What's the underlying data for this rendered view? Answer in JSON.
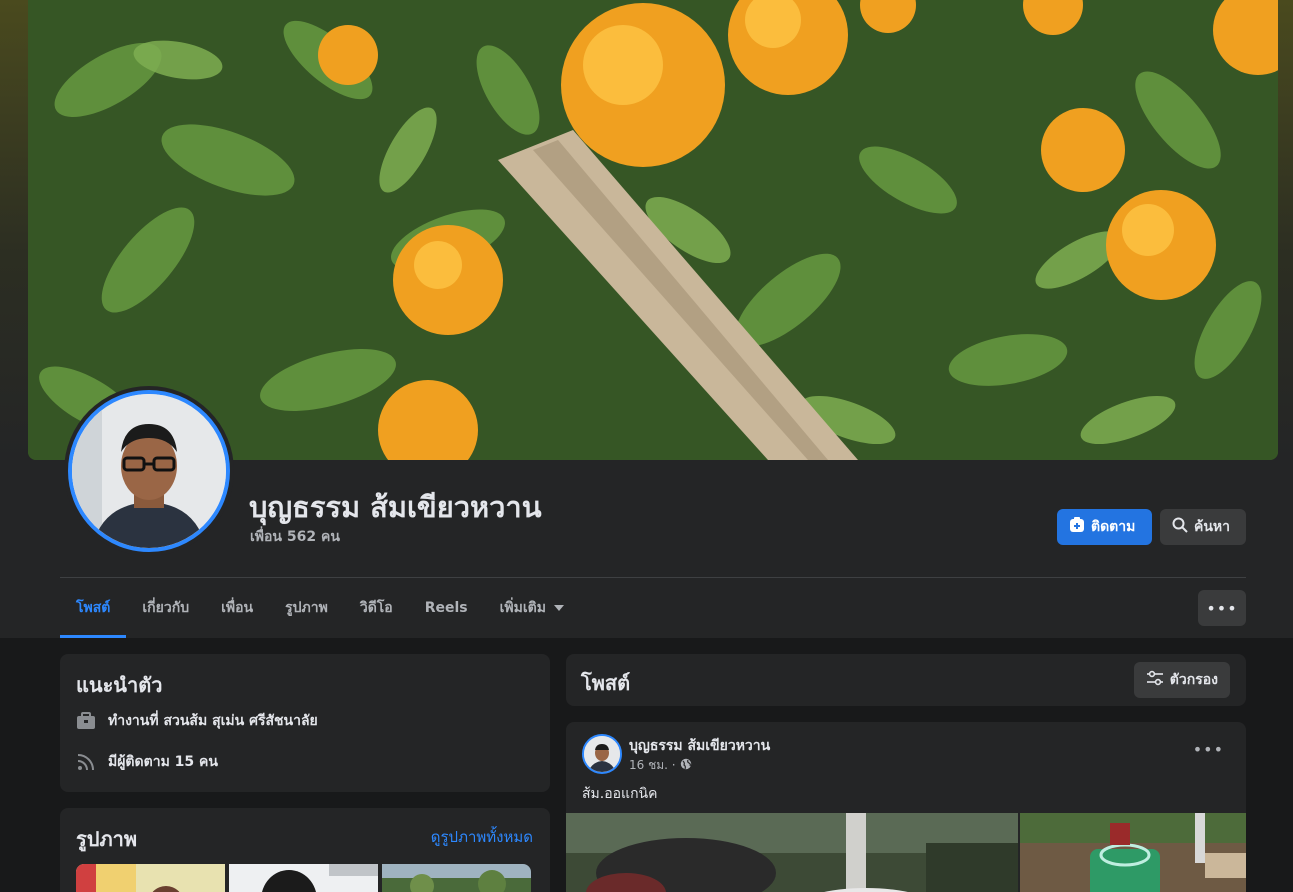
{
  "profile": {
    "name": "บุญธรรม ส้มเขียวหวาน",
    "friends": "เพื่อน 562 คน"
  },
  "actions": {
    "follow_label": "ติดตาม",
    "search_label": "ค้นหา",
    "more_label": "•••"
  },
  "tabs": [
    {
      "label": "โพสต์",
      "active": true
    },
    {
      "label": "เกี่ยวกับ"
    },
    {
      "label": "เพื่อน"
    },
    {
      "label": "รูปภาพ"
    },
    {
      "label": "วิดีโอ"
    },
    {
      "label": "Reels"
    },
    {
      "label": "เพิ่มเติม"
    }
  ],
  "intro": {
    "title": "แนะนำตัว",
    "work": "ทำงานที่ สวนส้ม สุเม่น ศรีสัชนาลัย",
    "followers": "มีผู้ติดตาม 15 คน"
  },
  "photos": {
    "title": "รูปภาพ",
    "see_all": "ดูรูปภาพทั้งหมด"
  },
  "posts": {
    "title": "โพสต์",
    "filter_label": "ตัวกรอง"
  },
  "post": {
    "author": "บุญธรรม ส้มเขียวหวาน",
    "time": "16 ชม. ·",
    "text": "ส้ม.ออแกนิค",
    "options": "•••"
  },
  "colors": {
    "accent": "#2d88ff",
    "follow_button": "#2374e1",
    "card": "#242526",
    "background": "#18191a"
  }
}
